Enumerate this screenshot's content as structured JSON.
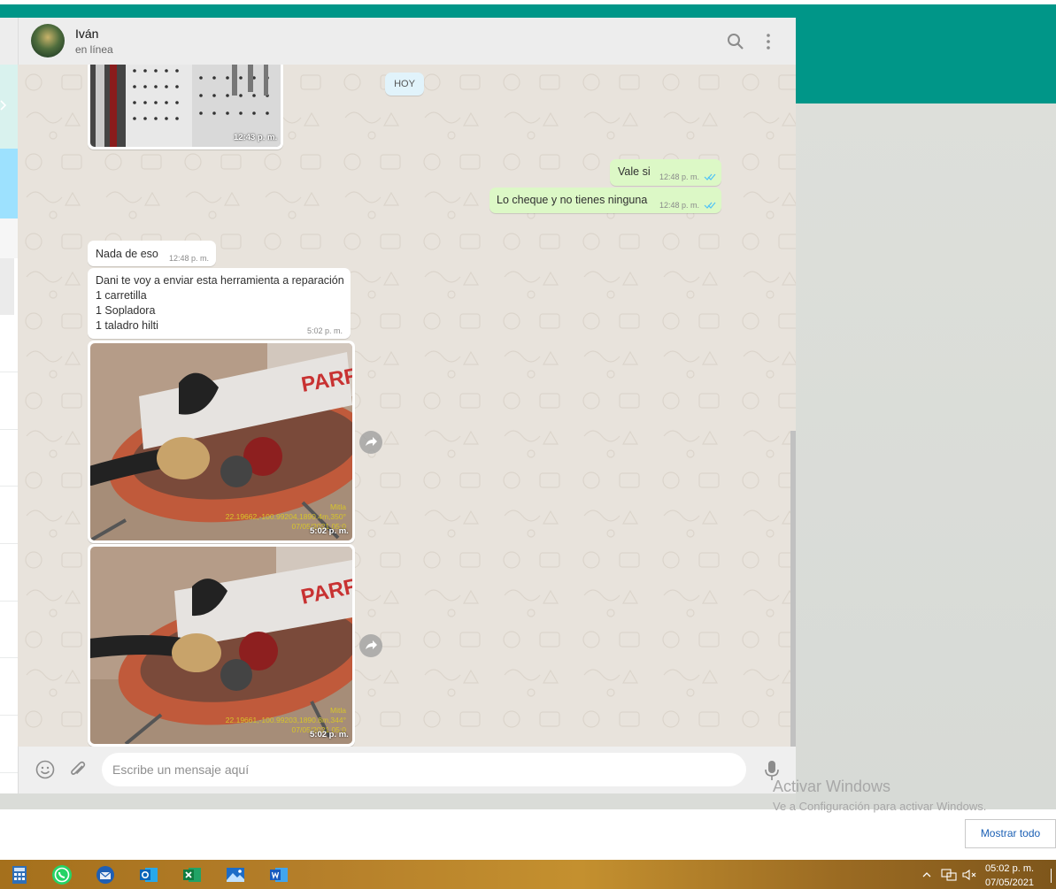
{
  "chat": {
    "contact_name": "Iván",
    "contact_status": "en línea",
    "day_badge": "HOY",
    "messages": [
      {
        "direction": "in",
        "type": "image",
        "time": "12:43 p. m."
      },
      {
        "direction": "out",
        "type": "text",
        "text": "Vale si",
        "time": "12:48 p. m.",
        "status": "read"
      },
      {
        "direction": "out",
        "type": "text",
        "text": "Lo cheque y no tienes ninguna",
        "time": "12:48 p. m.",
        "status": "read"
      },
      {
        "direction": "in",
        "type": "text",
        "text": "Nada de eso",
        "time": "12:48 p. m."
      },
      {
        "direction": "in",
        "type": "text",
        "lines": [
          "Dani te voy a enviar esta herramienta a reparación",
          "1 carretilla",
          "1 Sopladora",
          "1 taladro hilti"
        ],
        "time": "5:02 p. m."
      },
      {
        "direction": "in",
        "type": "image",
        "time": "5:02 p. m.",
        "stamp_lines": [
          "Mitla",
          "22.19662,-100.99204,1890.4m,350°",
          "07/05/2021 05:0"
        ]
      },
      {
        "direction": "in",
        "type": "image",
        "time": "5:02 p. m.",
        "stamp_lines": [
          "Mitla",
          "22.19661,-100.99203,1890.8m,344°",
          "07/05/2021 05:0"
        ]
      }
    ]
  },
  "composer": {
    "placeholder": "Escribe un mensaje aquí"
  },
  "watermark": {
    "title": "Activar Windows",
    "subtitle": "Ve a Configuración para activar Windows."
  },
  "downloads_bar": {
    "show_all_label": "Mostrar todo"
  },
  "taskbar": {
    "apps": [
      "calculator-icon",
      "whatsapp-icon",
      "thunderbird-icon",
      "outlook-icon",
      "excel-icon",
      "photos-icon",
      "word-icon"
    ],
    "clock_time": "05:02 p. m.",
    "clock_date": "07/05/2021"
  },
  "colors": {
    "teal": "#009688",
    "outgoing_bubble": "#dcf8c6",
    "read_tick": "#4fc3f7"
  }
}
